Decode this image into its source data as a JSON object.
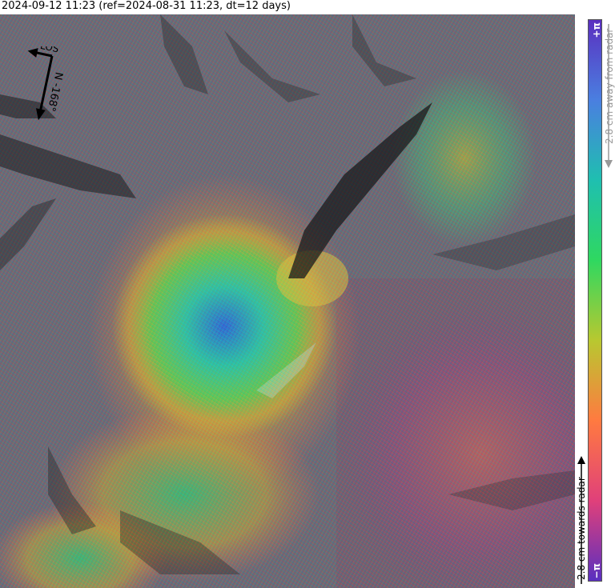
{
  "title": "2024-09-12 11:23 (ref=2024-08-31 11:23, dt=12 days)",
  "compass": {
    "los_label": "LOS",
    "north_label": "N",
    "heading_label": "-168°"
  },
  "colorbar": {
    "top_label": "+π",
    "bottom_label": "−π",
    "away_label": "2.8 cm away from radar",
    "towards_label": "2.8 cm towards radar",
    "colors": [
      "#5a2fc0",
      "#4a7fe0",
      "#1fbfb0",
      "#2fd860",
      "#b8c830",
      "#ff7a40",
      "#e0407a",
      "#5a2fc0"
    ]
  }
}
